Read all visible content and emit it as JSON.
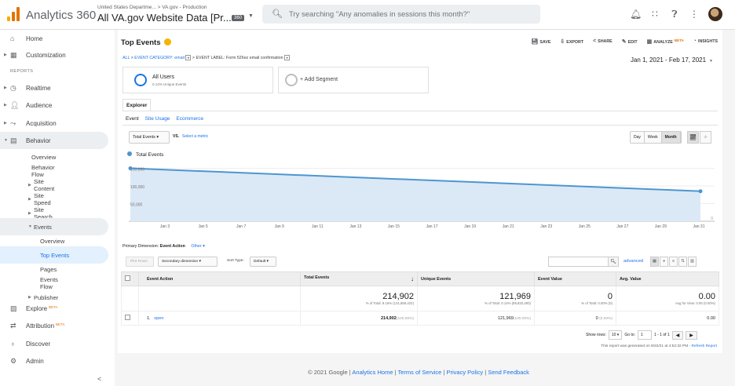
{
  "colors": {
    "accent": "#1a73e8",
    "line": "#4d96d0",
    "fill": "#dbe9f6",
    "logo": [
      "#f9ab00",
      "#e37400",
      "#e37400"
    ],
    "beta": "#e8710a"
  },
  "header": {
    "app_title": "Analytics 360",
    "account_path": "United States Departme... > VA.gov - Production",
    "account_name": "All VA.gov Website Data [Pr...",
    "account_badge": "360",
    "search_placeholder": "Try searching \"Any anomalies in sessions this month?\"",
    "icons": [
      "bell-icon",
      "apps-icon",
      "help-icon",
      "more-vert-icon",
      "avatar"
    ]
  },
  "sidebar": {
    "home": "Home",
    "customization": "Customization",
    "reports_heading": "REPORTS",
    "realtime": "Realtime",
    "audience": "Audience",
    "acquisition": "Acquisition",
    "behavior": "Behavior",
    "overview": "Overview",
    "behavior_flow": "Behavior Flow",
    "site_content": "Site Content",
    "site_speed": "Site Speed",
    "site_search": "Site Search",
    "events": "Events",
    "events_overview": "Overview",
    "top_events": "Top Events",
    "pages": "Pages",
    "events_flow": "Events Flow",
    "publisher": "Publisher",
    "explore": "Explore",
    "explore_beta": "BETA",
    "attribution": "Attribution",
    "attribution_beta": "BETA",
    "discover": "Discover",
    "admin": "Admin",
    "collapse": "<"
  },
  "report": {
    "title": "Top Events",
    "actions": {
      "save": "SAVE",
      "export": "EXPORT",
      "share": "SHARE",
      "edit": "EDIT",
      "analyze": "ANALYZE",
      "analyze_beta": "BETA",
      "insights": "INSIGHTS"
    },
    "breadcrumb": {
      "all": "ALL",
      "sep": ">",
      "category": "EVENT CATEGORY: email",
      "label": "EVENT LABEL: Form 526ez email confirmation"
    },
    "date_range": "Jan 1, 2021 - Feb 17, 2021",
    "segments": {
      "name": "All Users",
      "sub": "0.14% Unique Events",
      "add": "+ Add Segment"
    },
    "tab": "Explorer",
    "subtabs": {
      "event": "Event",
      "site_usage": "Site Usage",
      "ecommerce": "Ecommerce"
    },
    "metric": "Total Events",
    "vs": "VS.",
    "select_metric": "Select a metric",
    "period": {
      "day": "Day",
      "week": "Week",
      "month": "Month",
      "selected": "Month"
    },
    "legend": "Total Events"
  },
  "chart_data": {
    "type": "line",
    "series": [
      {
        "name": "Total Events",
        "x": [
          "Jan 1, 2021",
          "Feb 1, 2021"
        ],
        "values": [
          150000,
          85000
        ]
      }
    ],
    "x_ticks": [
      "Jan 3",
      "Jan 5",
      "Jan 7",
      "Jan 9",
      "Jan 11",
      "Jan 13",
      "Jan 15",
      "Jan 17",
      "Jan 19",
      "Jan 21",
      "Jan 23",
      "Jan 25",
      "Jan 27",
      "Jan 29",
      "Jan 31"
    ],
    "y_ticks": [
      "150,000",
      "100,000",
      "50,000"
    ],
    "y_right_label": "0",
    "ylim": [
      0,
      160000
    ],
    "grid": true
  },
  "table": {
    "primary_dimension_label": "Primary Dimension:",
    "primary_dimension": "Event Action",
    "other": "Other",
    "plot_rows": "Plot Rows",
    "secondary_dimension": "Secondary dimension",
    "sort_type_label": "Sort Type:",
    "sort_type": "Default",
    "advanced": "advanced",
    "headers": [
      "Event Action",
      "Total Events",
      "Unique Events",
      "Event Value",
      "Avg. Value"
    ],
    "totals": {
      "total_events": "214,902",
      "total_events_sub": "% of Total: 8.16% (121,859,422)",
      "unique_events": "121,969",
      "unique_events_sub": "% of Total: 0.14% (89,832,493)",
      "event_value": "0",
      "event_value_sub": "% of Total: 0.00% (0)",
      "avg_value": "0.00",
      "avg_value_sub": "Avg for View: 0.00 (0.00%)"
    },
    "rows": [
      {
        "index": "1.",
        "action": "open",
        "total": "214,902",
        "total_pct": "(100.00%)",
        "unique": "121,969",
        "unique_pct": "(100.00%)",
        "value": "0",
        "value_pct": "(0.00%)",
        "avg": "0.00"
      }
    ],
    "show_rows_label": "Show rows:",
    "show_rows": "10",
    "goto_label": "Go to:",
    "goto": "1",
    "range": "1 - 1 of 1",
    "generated": "This report was generated on 9/22/21 at 4:52:32 PM - ",
    "refresh": "Refresh Report"
  },
  "footer": {
    "copyright": "© 2021 Google |",
    "home": "Analytics Home",
    "terms": "Terms of Service",
    "privacy": "Privacy Policy",
    "feedback": "Send Feedback",
    "sep": "|"
  }
}
